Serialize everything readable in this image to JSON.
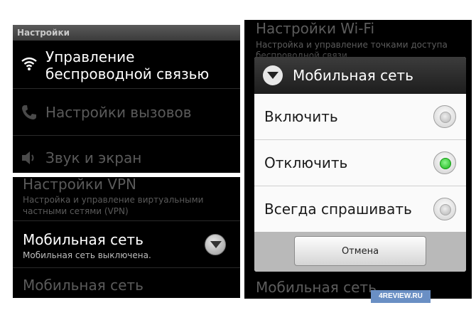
{
  "settings": {
    "title": "Настройки",
    "items": [
      {
        "label_line1": "Управление",
        "label_line2": "беспроводной связью",
        "icon": "wifi-icon",
        "enabled": true
      },
      {
        "label": "Настройки вызовов",
        "icon": "phone-icon",
        "enabled": false
      },
      {
        "label": "Звук и экран",
        "icon": "speaker-icon",
        "enabled": false
      }
    ]
  },
  "mobile_settings": {
    "vpn": {
      "title": "Настройки VPN",
      "sub1": "Настройка и управление виртуальными",
      "sub2": "частными сетями (VPN)"
    },
    "mobile_network": {
      "title": "Мобильная сеть",
      "sub": "Мобильная сеть выключена."
    },
    "mobile_network_2": {
      "title": "Мобильная сеть"
    }
  },
  "dialog_background": {
    "wifi_title": "Настройки Wi-Fi",
    "wifi_sub1": "Настройка и управление точками доступа",
    "wifi_sub2": "беспроводной связи",
    "bottom_title": "Мобильная сеть"
  },
  "dialog": {
    "title": "Мобильная сеть",
    "options": [
      {
        "label": "Включить",
        "selected": false
      },
      {
        "label": "Отключить",
        "selected": true
      },
      {
        "label": "Всегда спрашивать",
        "selected": false
      }
    ],
    "cancel_label": "Отмена"
  },
  "watermark": "4REVIEW.RU",
  "colors": {
    "panel_bg": "#000000",
    "dialog_bg": "#fafafa",
    "radio_selected": "#18b418",
    "watermark_bg": "#6a8fc4"
  }
}
